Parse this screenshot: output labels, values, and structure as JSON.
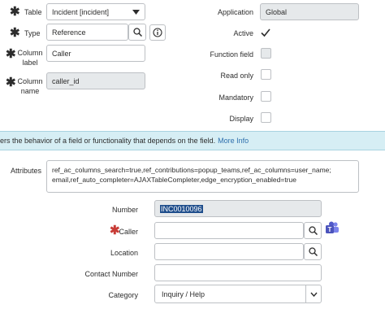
{
  "form_top": {
    "table": {
      "label": "Table",
      "value": "Incident [incident]"
    },
    "type": {
      "label": "Type",
      "value": "Reference"
    },
    "column_label": {
      "label": "Column label",
      "value": "Caller"
    },
    "column_name": {
      "label": "Column name",
      "value": "caller_id"
    },
    "application": {
      "label": "Application",
      "value": "Global"
    },
    "active": {
      "label": "Active",
      "checked": true
    },
    "function_field": {
      "label": "Function field",
      "checked": false
    },
    "read_only": {
      "label": "Read only",
      "checked": false
    },
    "mandatory": {
      "label": "Mandatory",
      "checked": false
    },
    "display": {
      "label": "Display",
      "checked": false
    }
  },
  "banner": {
    "text": "ers the behavior of a field or functionality that depends on the field.",
    "link": "More Info"
  },
  "attributes": {
    "label": "Attributes",
    "line1": "ref_ac_columns_search=true,ref_contributions=popup_teams,ref_ac_columns=user_name;",
    "line2": "email,ref_auto_completer=AJAXTableCompleter,edge_encryption_enabled=true"
  },
  "incident": {
    "number": {
      "label": "Number",
      "value": "INC0010096"
    },
    "caller": {
      "label": "Caller",
      "value": ""
    },
    "location": {
      "label": "Location",
      "value": ""
    },
    "contact_number": {
      "label": "Contact Number",
      "value": ""
    },
    "category": {
      "label": "Category",
      "value": "Inquiry / Help"
    }
  },
  "colors": {
    "banner_bg": "#d6eef4",
    "mandatory_star": "#c83c36",
    "link": "#2e6fad",
    "teams_icon": "#5059c9"
  }
}
